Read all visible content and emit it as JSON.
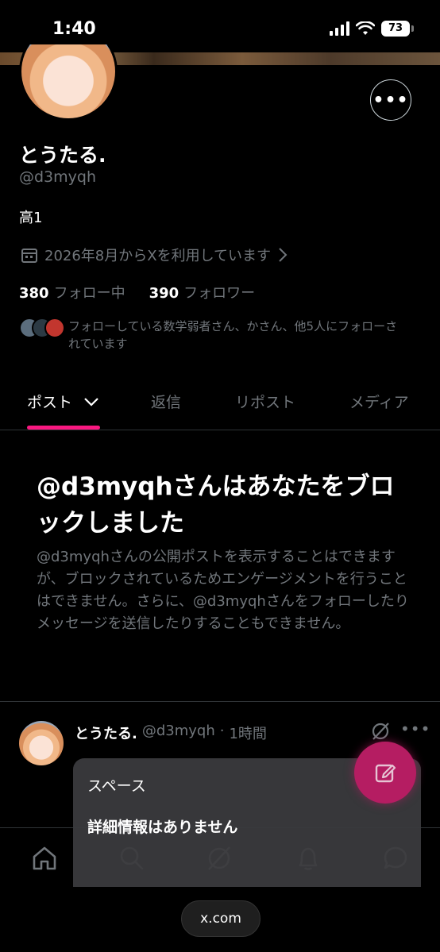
{
  "status_bar": {
    "time": "1:40",
    "battery": "73"
  },
  "profile": {
    "name": "とうたる.",
    "handle": "@d3myqh",
    "bio": "高1",
    "joined": "2026年8月からXを利用しています",
    "following_count": "380",
    "following_label": "フォロー中",
    "followers_count": "390",
    "followers_label": "フォロワー",
    "mutuals_text": "フォローしている数学弱者さん、かさん、他5人にフォローされています"
  },
  "tabs": [
    {
      "label": "ポスト"
    },
    {
      "label": "返信"
    },
    {
      "label": "リポスト"
    },
    {
      "label": "メディア"
    }
  ],
  "blocked": {
    "title": "@d3myqhさんはあなたをブロックしました",
    "description": "@d3myqhさんの公開ポストを表示することはできますが、ブロックされているためエンゲージメントを行うことはできません。さらに、@d3myqhさんをフォローしたりメッセージを送信したりすることもできません。"
  },
  "post": {
    "name": "とうたる.",
    "handle": "@d3myqh",
    "dot": "·",
    "time": "1時間"
  },
  "popover": {
    "title": "スペース",
    "body": "詳細情報はありません"
  },
  "browser": {
    "url": "x.com"
  },
  "colors": {
    "accent": "#f91880",
    "fab": "#b51d62",
    "muted": "#71767b"
  }
}
